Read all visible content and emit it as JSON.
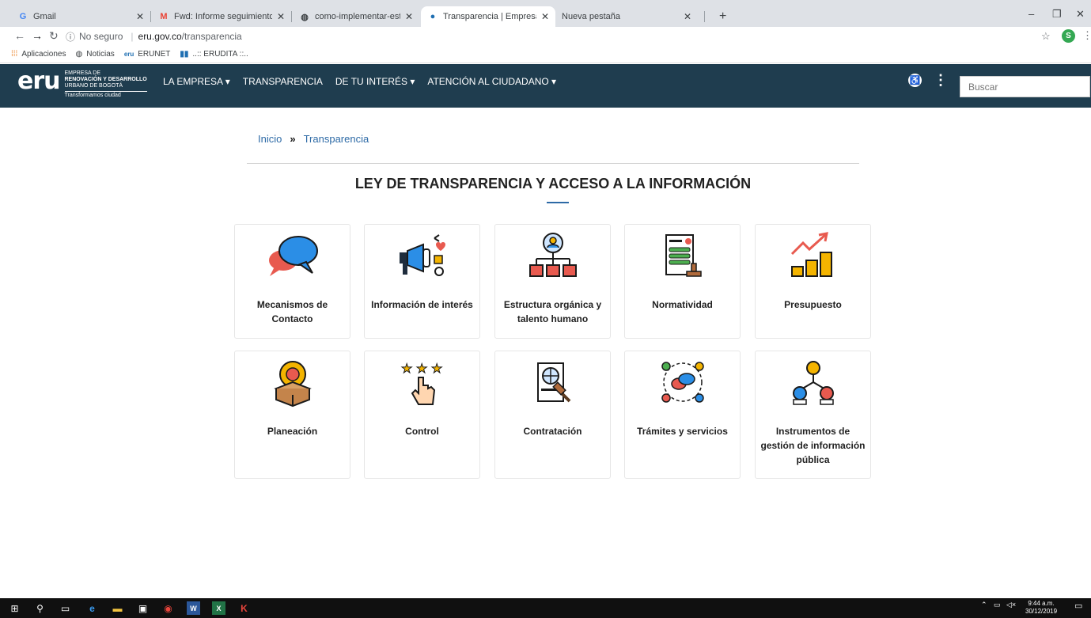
{
  "browser": {
    "tabs": [
      {
        "icon": "gmail-icon",
        "label": "Gmail"
      },
      {
        "icon": "gmail-icon",
        "label": "Fwd: Informe seguimiento Ley Tr"
      },
      {
        "icon": "globe-icon",
        "label": "como-implementar-estandares-t"
      },
      {
        "icon": "eru-icon",
        "label": "Transparencia | Empresa de Reno"
      },
      {
        "icon": "",
        "label": "Nueva pestaña"
      }
    ],
    "url_security": "No seguro",
    "url_domain": "eru.gov.co",
    "url_path": "/transparencia",
    "profile_initial": "S",
    "bookmarks": [
      {
        "icon": "apps-icon",
        "label": "Aplicaciones"
      },
      {
        "icon": "globe-icon",
        "label": "Noticias"
      },
      {
        "icon": "eru-icon",
        "label": "ERUNET"
      },
      {
        "icon": "erudita-icon",
        "label": "..:: ERUDITA ::.."
      }
    ]
  },
  "site": {
    "logo": {
      "mark": "eru",
      "line1": "EMPRESA DE",
      "line2": "RENOVACIÓN Y DESARROLLO",
      "line3": "URBANO DE BOGOTÁ",
      "tagline": "Transformamos ciudad"
    },
    "nav": [
      {
        "label": "LA EMPRESA ▾"
      },
      {
        "label": "TRANSPARENCIA"
      },
      {
        "label": "DE TU INTERÉS ▾"
      },
      {
        "label": "ATENCIÓN AL CIUDADANO ▾"
      }
    ],
    "search_placeholder": "Buscar",
    "accent_color": "#2d6aa6",
    "header_color": "#1f3d4f"
  },
  "breadcrumb": {
    "home": "Inicio",
    "separator": "»",
    "current": "Transparencia"
  },
  "page_title": "LEY DE TRANSPARENCIA Y ACCESO A LA INFORMACIÓN",
  "cards": [
    {
      "icon": "chat-bubbles-icon",
      "label": "Mecanismos de Contacto"
    },
    {
      "icon": "megaphone-icon",
      "label": "Información de interés"
    },
    {
      "icon": "org-chart-icon",
      "label": "Estructura orgánica y talento humano"
    },
    {
      "icon": "document-stamp-icon",
      "label": "Normatividad"
    },
    {
      "icon": "budget-chart-icon",
      "label": "Presupuesto"
    },
    {
      "icon": "lightbulb-box-icon",
      "label": "Planeación"
    },
    {
      "icon": "rating-hand-icon",
      "label": "Control"
    },
    {
      "icon": "contract-gavel-icon",
      "label": "Contratación"
    },
    {
      "icon": "people-chat-icon",
      "label": "Trámites y servicios"
    },
    {
      "icon": "network-people-icon",
      "label": "Instrumentos de gestión de información pública"
    }
  ],
  "taskbar": {
    "time": "9:44 a.m.",
    "date": "30/12/2019"
  }
}
